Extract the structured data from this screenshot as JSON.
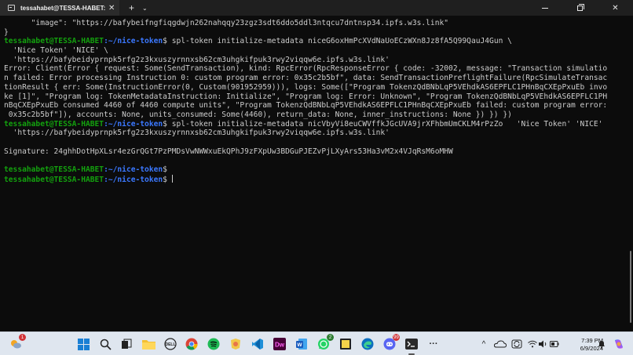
{
  "window": {
    "tab_title": "tessahabet@TESSA-HABET: ~",
    "close_glyph": "✕",
    "new_tab_glyph": "+",
    "dropdown_glyph": "⌄"
  },
  "terminal": {
    "prompt_user": "tessahabet@TESSA-HABET",
    "prompt_path": ":~/nice-token",
    "prompt_symbol": "$",
    "lines": [
      "      \"image\": \"https://bafybeifngfiqgdwjn262nahqqy23zgz3sdt6ddo5ddl3ntqcu7dntnsp34.ipfs.w3s.link\"",
      "}",
      {
        "cmd": " spl-token initialize-metadata niceG6oxHmPcXVdNaUoECzWXn8Jz8fA5Q99QauJ4Gun \\"
      },
      "  'Nice Token' 'NICE' \\",
      "  'https://bafybeidyprnpk5rfg2z3kxuszyrnnxsb62cm3uhgkifpuk3rwy2viqqw6e.ipfs.w3s.link'",
      "Error: Client(Error { request: Some(SendTransaction), kind: RpcError(RpcResponseError { code: -32002, message: \"Transaction simulatio",
      "n failed: Error processing Instruction 0: custom program error: 0x35c2b5bf\", data: SendTransactionPreflightFailure(RpcSimulateTransac",
      "tionResult { err: Some(InstructionError(0, Custom(901952959))), logs: Some([\"Program TokenzQdBNbLqP5VEhdkAS6EPFLC1PHnBqCXEpPxuEb invo",
      "ke [1]\", \"Program log: TokenMetadataInstruction: Initialize\", \"Program log: Error: Unknown\", \"Program TokenzQdBNbLqP5VEhdkAS6EPFLC1PH",
      "nBqCXEpPxuEb consumed 4460 of 4460 compute units\", \"Program TokenzQdBNbLqP5VEhdkAS6EPFLC1PHnBqCXEpPxuEb failed: custom program error:",
      " 0x35c2b5bf\"]), accounts: None, units_consumed: Some(4460), return_data: None, inner_instructions: None }) }) })",
      {
        "cmd": " spl-token initialize-metadata nicVbyVi8euCWVffkJGcUVA9jrXFhbmUmCKLM4rPzZo   'Nice Token' 'NICE'"
      },
      "  'https://bafybeidyprnpk5rfg2z3kxuszyrnnxsb62cm3uhgkifpuk3rwy2viqqw6e.ipfs.w3s.link'",
      "",
      "Signature: 24ghhDotHpXLsr4ezGrQGt7PzPMDsVwNWWxuEkQPhJ9zFXpUw3BDGuPJEZvPjLXyArs53Ha3vM2x4VJqRsM6oMHW",
      "",
      {
        "cmd": ""
      },
      {
        "cmd": " ",
        "cursor": true
      }
    ]
  },
  "taskbar": {
    "notification_badge": "1",
    "whatsapp_badge": "2",
    "discord_badge": "99",
    "more_glyph": "···",
    "tray_chevron": "^",
    "time": "7:39 PM",
    "date": "6/9/2024"
  }
}
